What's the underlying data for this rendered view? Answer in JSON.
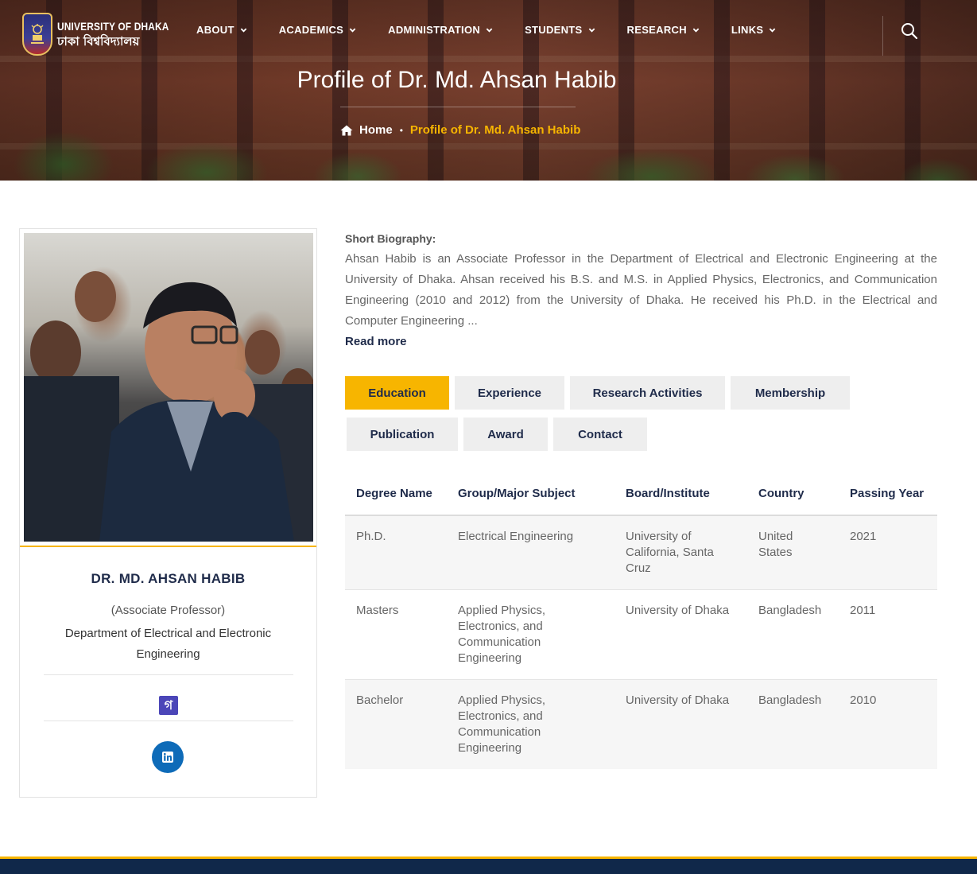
{
  "header": {
    "logo": {
      "name_en": "UNIVERSITY OF DHAKA",
      "name_bn": "ঢাকা বিশ্ববিদ্যালয়"
    },
    "nav": [
      {
        "label": "ABOUT"
      },
      {
        "label": "ACADEMICS"
      },
      {
        "label": "ADMINISTRATION"
      },
      {
        "label": "STUDENTS"
      },
      {
        "label": "RESEARCH"
      },
      {
        "label": "LINKS"
      }
    ],
    "search_icon": "search-icon"
  },
  "hero": {
    "title": "Profile of Dr. Md. Ahsan Habib",
    "breadcrumb": {
      "home": "Home",
      "separator": "•",
      "current": "Profile of Dr. Md. Ahsan Habib"
    }
  },
  "profile": {
    "name": "DR. MD. AHSAN HABIB",
    "designation": "(Associate Professor)",
    "department": "Department of Electrical and Electronic Engineering",
    "scholar_glyph": "গ",
    "social_icon": "linkedin-icon"
  },
  "bio": {
    "label": "Short Biography:",
    "text": "Ahsan Habib is an Associate Professor in the Department of Electrical and Electronic Engineering at the University of Dhaka. Ahsan received his B.S. and M.S. in Applied Physics, Electronics, and Communication Engineering (2010 and 2012) from the University of Dhaka. He received his Ph.D. in the Electrical and Computer Engineering ...",
    "read_more": "Read more"
  },
  "tabs": [
    {
      "label": "Education",
      "active": true
    },
    {
      "label": "Experience",
      "active": false
    },
    {
      "label": "Research Activities",
      "active": false
    },
    {
      "label": "Membership",
      "active": false
    },
    {
      "label": "Publication",
      "active": false
    },
    {
      "label": "Award",
      "active": false
    },
    {
      "label": "Contact",
      "active": false
    }
  ],
  "education_table": {
    "headers": [
      "Degree Name",
      "Group/Major Subject",
      "Board/Institute",
      "Country",
      "Passing Year"
    ],
    "rows": [
      [
        "Ph.D.",
        "Electrical Engineering",
        "University of California, Santa Cruz",
        "United States",
        "2021"
      ],
      [
        "Masters",
        "Applied Physics, Electronics, and Communication Engineering",
        "University of Dhaka",
        "Bangladesh",
        "2011"
      ],
      [
        "Bachelor",
        "Applied Physics, Electronics, and Communication Engineering",
        "University of Dhaka",
        "Bangladesh",
        "2010"
      ]
    ]
  },
  "colors": {
    "accent": "#f7b500",
    "navy": "#1f2b4a",
    "footer": "#10284a",
    "linkedin": "#0e6bb8",
    "scholar": "#4b46b8"
  }
}
